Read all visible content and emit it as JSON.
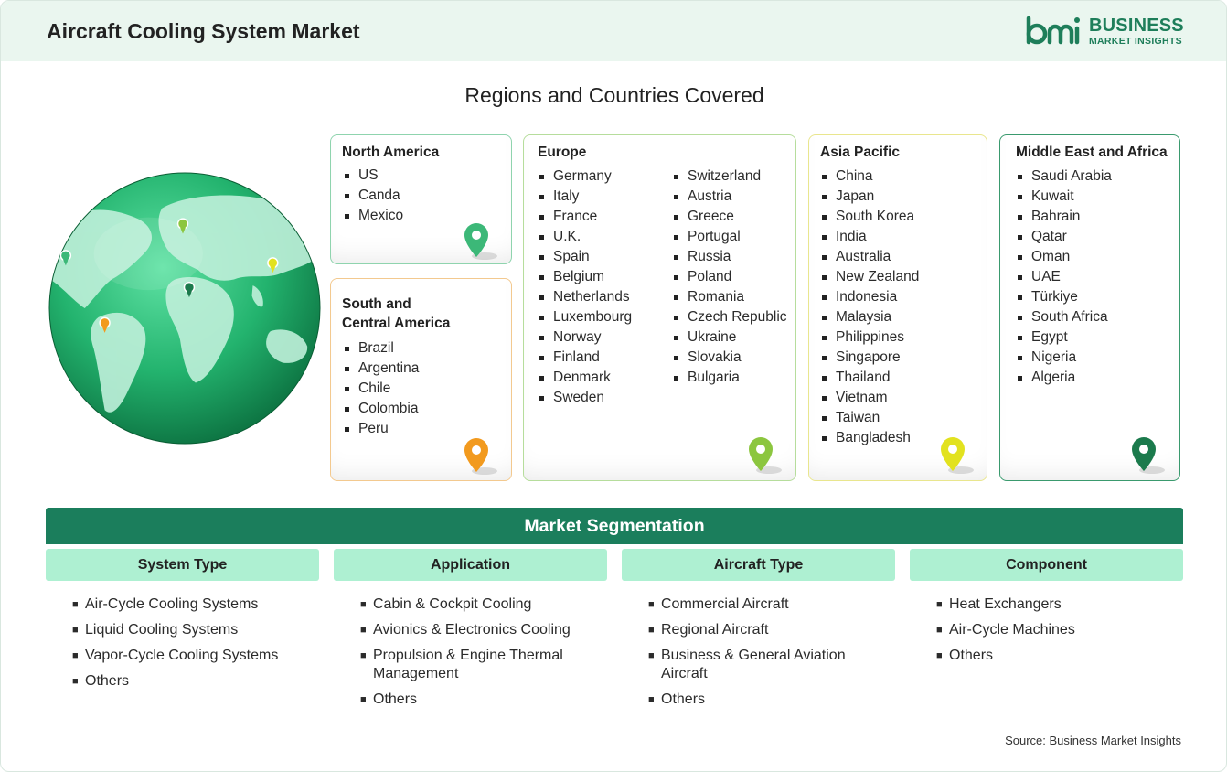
{
  "header": {
    "title": "Aircraft Cooling System Market",
    "logo_main": "BUSINESS",
    "logo_sub": "MARKET INSIGHTS",
    "logo_mark": "bmi"
  },
  "regions_title": "Regions and Countries Covered",
  "regions": {
    "north_america": {
      "name": "North America",
      "countries": [
        "US",
        "Canda",
        "Mexico"
      ],
      "pin_color": "#3cb878"
    },
    "south_central_america": {
      "name_line1": "South and",
      "name_line2": "Central America",
      "countries": [
        "Brazil",
        "Argentina",
        "Chile",
        "Colombia",
        "Peru"
      ],
      "pin_color": "#f29a1e"
    },
    "europe": {
      "name": "Europe",
      "countries_col1": [
        "Germany",
        "Italy",
        "France",
        "U.K.",
        "Spain",
        "Belgium",
        "Netherlands",
        "Luxembourg",
        "Norway",
        "Finland",
        "Denmark",
        "Sweden"
      ],
      "countries_col2": [
        "Switzerland",
        "Austria",
        "Greece",
        "Portugal",
        "Russia",
        "Poland",
        "Romania",
        "Czech Republic",
        "Ukraine",
        "Slovakia",
        "Bulgaria"
      ],
      "pin_color": "#8cc63f"
    },
    "asia_pacific": {
      "name": "Asia Pacific",
      "countries": [
        "China",
        "Japan",
        "South Korea",
        "India",
        "Australia",
        "New Zealand",
        "Indonesia",
        "Malaysia",
        "Philippines",
        "Singapore",
        "Thailand",
        "Vietnam",
        "Taiwan",
        "Bangladesh"
      ],
      "pin_color": "#e2e21f"
    },
    "middle_east_africa": {
      "name": "Middle East and Africa",
      "countries": [
        "Saudi Arabia",
        "Kuwait",
        "Bahrain",
        "Qatar",
        "Oman",
        "UAE",
        "Türkiye",
        "South Africa",
        "Egypt",
        "Nigeria",
        "Algeria"
      ],
      "pin_color": "#1b7a4c"
    }
  },
  "segmentation": {
    "title": "Market Segmentation",
    "columns": [
      {
        "heading": "System Type",
        "items": [
          "Air-Cycle Cooling Systems",
          "Liquid Cooling Systems",
          "Vapor-Cycle Cooling Systems",
          "Others"
        ]
      },
      {
        "heading": "Application",
        "items": [
          "Cabin & Cockpit Cooling",
          "Avionics & Electronics Cooling",
          "Propulsion & Engine Thermal Management",
          "Others"
        ]
      },
      {
        "heading": "Aircraft Type",
        "items": [
          "Commercial Aircraft",
          "Regional Aircraft",
          "Business & General Aviation Aircraft",
          "Others"
        ]
      },
      {
        "heading": "Component",
        "items": [
          "Heat Exchangers",
          "Air-Cycle Machines",
          "Others"
        ]
      }
    ]
  },
  "source": "Source: Business Market Insights",
  "colors": {
    "brand": "#1b7e5c",
    "segment_head": "#aef0d2",
    "header_bg": "#eaf6ef"
  }
}
